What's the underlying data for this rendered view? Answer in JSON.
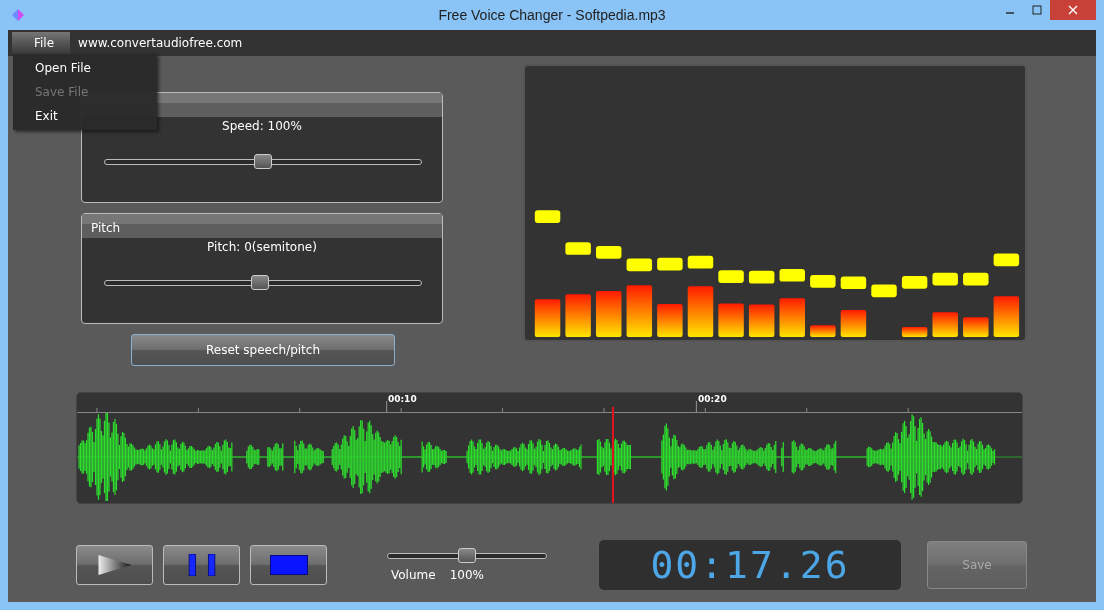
{
  "window": {
    "title": "Free Voice Changer - Softpedia.mp3"
  },
  "menu_bar": {
    "items": [
      {
        "label": "File",
        "selected": true
      }
    ],
    "link": "www.convertaudiofree.com"
  },
  "file_menu": {
    "items": [
      {
        "label": "Open File",
        "disabled": false
      },
      {
        "label": "Save File",
        "disabled": true
      },
      {
        "label": "Exit",
        "disabled": false
      }
    ]
  },
  "speed": {
    "reading": "Speed: 100%",
    "level": 0.5
  },
  "pitch": {
    "title": "Pitch",
    "reading": "Pitch: 0(semitone)",
    "level": 0.49
  },
  "reset_button": "Reset speech/pitch",
  "timeline": {
    "ticks": [
      "00:10",
      "00:20"
    ],
    "level": 0.566
  },
  "volume": {
    "label": "Volume",
    "reading": "100%",
    "level": 0.5
  },
  "time_display": "00:17.26",
  "save_button": {
    "label": "Save",
    "disabled": true
  }
}
